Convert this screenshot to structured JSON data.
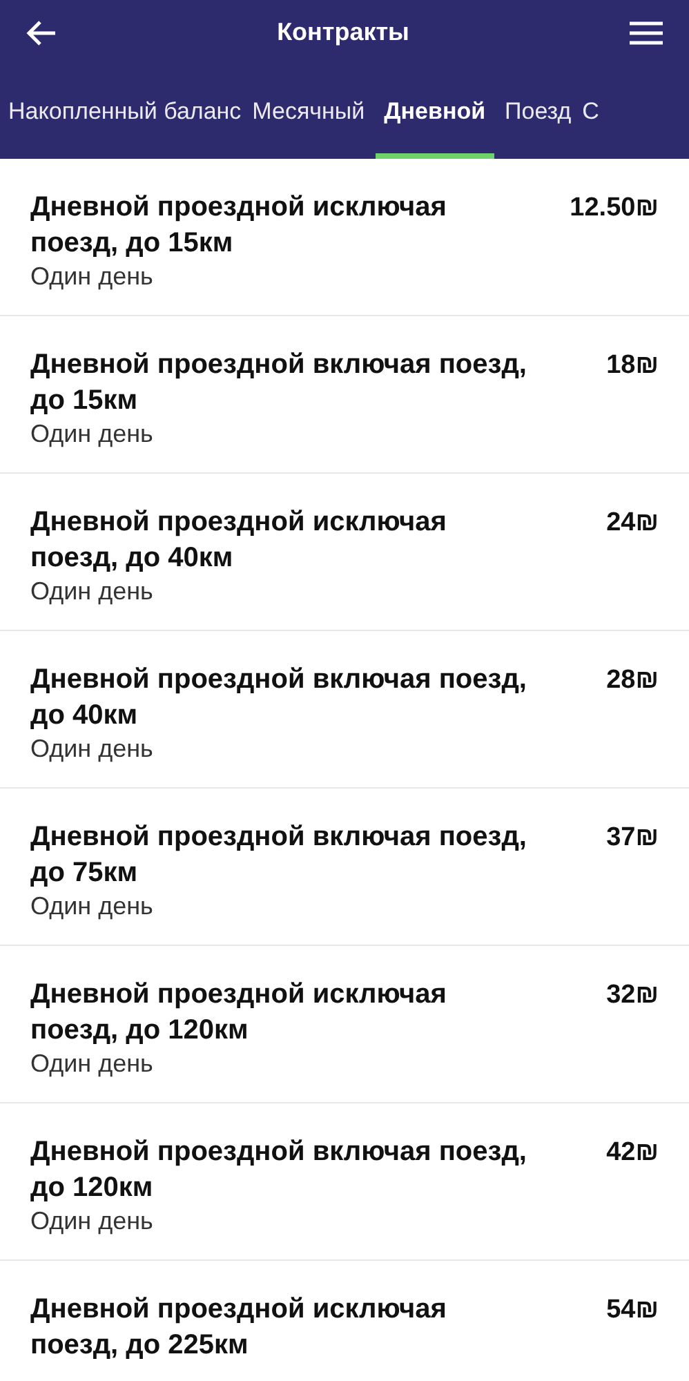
{
  "header": {
    "title": "Контракты"
  },
  "tabs": [
    {
      "label": "Накопленный баланс",
      "selected": false
    },
    {
      "label": "Месячный",
      "selected": false
    },
    {
      "label": "Дневной",
      "selected": true
    },
    {
      "label": "Поезд",
      "selected": false
    },
    {
      "label": "С",
      "selected": false
    }
  ],
  "contracts": [
    {
      "title": "Дневной проездной исключая поезд, до 15км",
      "subtitle": "Один день",
      "price": "12.50₪"
    },
    {
      "title": "Дневной проездной включая поезд, до 15км",
      "subtitle": "Один день",
      "price": "18₪"
    },
    {
      "title": "Дневной проездной исключая поезд, до 40км",
      "subtitle": "Один день",
      "price": "24₪"
    },
    {
      "title": "Дневной проездной включая поезд, до 40км",
      "subtitle": "Один день",
      "price": "28₪"
    },
    {
      "title": "Дневной проездной включая поезд, до 75км",
      "subtitle": "Один день",
      "price": "37₪"
    },
    {
      "title": "Дневной проездной исключая поезд, до 120км",
      "subtitle": "Один день",
      "price": "32₪"
    },
    {
      "title": "Дневной проездной включая поезд, до 120км",
      "subtitle": "Один день",
      "price": "42₪"
    },
    {
      "title": "Дневной проездной исключая поезд, до 225км",
      "price": "54₪"
    }
  ]
}
